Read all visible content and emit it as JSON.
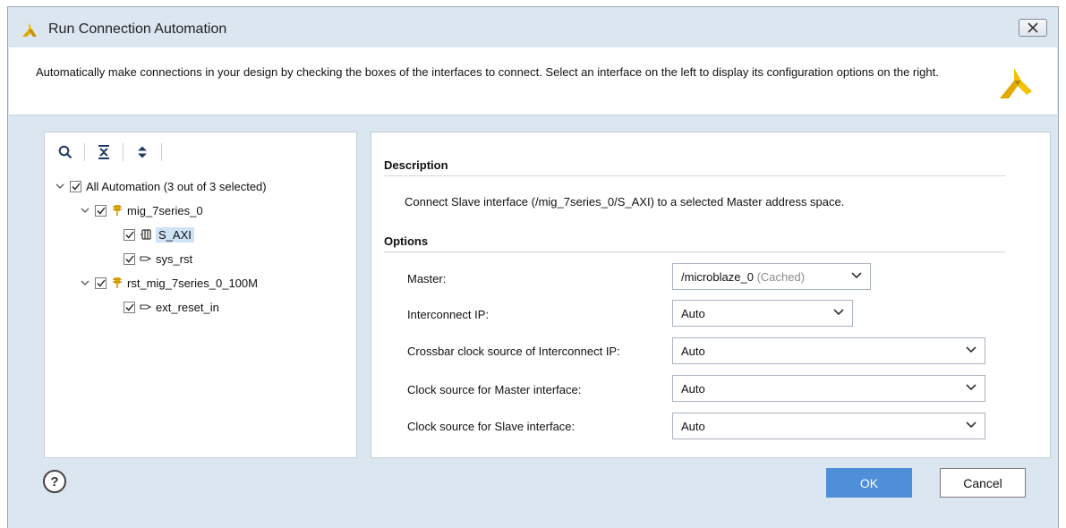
{
  "window": {
    "title": "Run Connection Automation",
    "close_label": "⊠"
  },
  "header": {
    "description": "Automatically make connections in your design by checking the boxes of the interfaces to connect. Select an interface on the left to display its configuration options on the right."
  },
  "tree": {
    "items": [
      {
        "label": "All Automation (3 out of 3 selected)",
        "icon": "none",
        "expanded": true,
        "checked": true
      },
      {
        "label": "mig_7series_0",
        "icon": "ip-block-icon",
        "expanded": true,
        "checked": true
      },
      {
        "label": "S_AXI",
        "icon": "bus-interface-icon",
        "checked": true,
        "selected": true
      },
      {
        "label": "sys_rst",
        "icon": "pin-icon",
        "checked": true
      },
      {
        "label": "rst_mig_7series_0_100M",
        "icon": "ip-block-icon",
        "expanded": true,
        "checked": true
      },
      {
        "label": "ext_reset_in",
        "icon": "pin-icon",
        "checked": true
      }
    ]
  },
  "details": {
    "description_title": "Description",
    "description_text": "Connect Slave interface (/mig_7series_0/S_AXI) to a selected Master address space.",
    "options_title": "Options",
    "options": [
      {
        "label": "Master:",
        "value": "/microblaze_0",
        "value_suffix": "(Cached)"
      },
      {
        "label": "Interconnect IP:",
        "value": "Auto"
      },
      {
        "label": "Crossbar clock source of Interconnect IP:",
        "value": "Auto"
      },
      {
        "label": "Clock source for Master interface:",
        "value": "Auto"
      },
      {
        "label": "Clock source for Slave interface:",
        "value": "Auto"
      }
    ]
  },
  "footer": {
    "help_label": "?",
    "ok_label": "OK",
    "cancel_label": "Cancel"
  },
  "colors": {
    "accent": "#4f8ed8",
    "dialog_bg": "#dce6f1",
    "selection": "#cfe3f7",
    "xilinx_yellow": "#e8b400"
  }
}
